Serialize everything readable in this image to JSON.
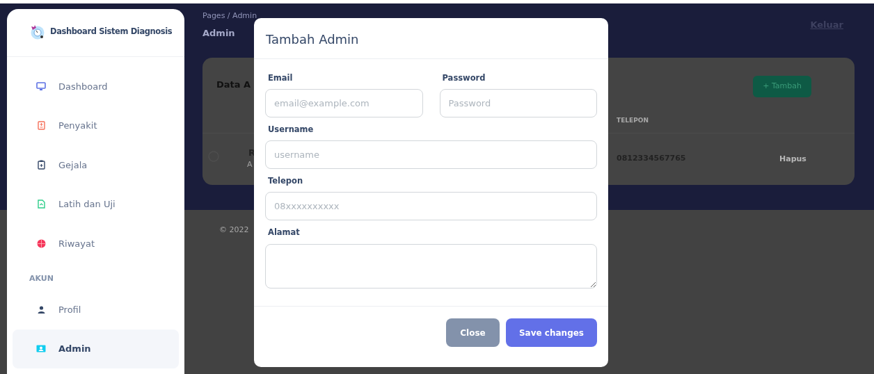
{
  "sidebar": {
    "brand": "Dashboard Sistem Diagnosis",
    "sections": [
      {
        "items": [
          {
            "label": "Dashboard",
            "selected": false
          },
          {
            "label": "Penyakit",
            "selected": false
          },
          {
            "label": "Gejala",
            "selected": false
          },
          {
            "label": "Latih dan Uji",
            "selected": false
          },
          {
            "label": "Riwayat",
            "selected": false
          }
        ]
      },
      {
        "heading": "AKUN",
        "items": [
          {
            "label": "Profil",
            "selected": false
          },
          {
            "label": "Admin",
            "selected": true
          }
        ]
      }
    ]
  },
  "header": {
    "breadcrumb": [
      "Pages",
      "Admin"
    ],
    "separator": "/",
    "title": "Admin",
    "logout": "Keluar"
  },
  "card": {
    "title": "Data A",
    "add_button": "+ Tambah",
    "table": {
      "columns": [
        "TELEPON"
      ],
      "rows": [
        {
          "name": "R",
          "subtitle": "A",
          "telepon": "0812334567765",
          "action": "Hapus"
        }
      ]
    }
  },
  "footer": "© 2022",
  "modal": {
    "title": "Tambah Admin",
    "rows": [
      [
        {
          "label": "Email",
          "placeholder": "email@example.com",
          "kind": "input"
        },
        {
          "label": "Password",
          "placeholder": "Password",
          "kind": "password"
        }
      ],
      [
        {
          "label": "Username",
          "placeholder": "username",
          "kind": "input"
        }
      ],
      [
        {
          "label": "Telepon",
          "placeholder": "08xxxxxxxxxx",
          "kind": "input"
        }
      ],
      [
        {
          "label": "Alamat",
          "kind": "textarea"
        }
      ]
    ],
    "buttons": [
      {
        "label": "Close",
        "kind": "secondary"
      },
      {
        "label": "Save changes",
        "kind": "primary"
      }
    ]
  }
}
